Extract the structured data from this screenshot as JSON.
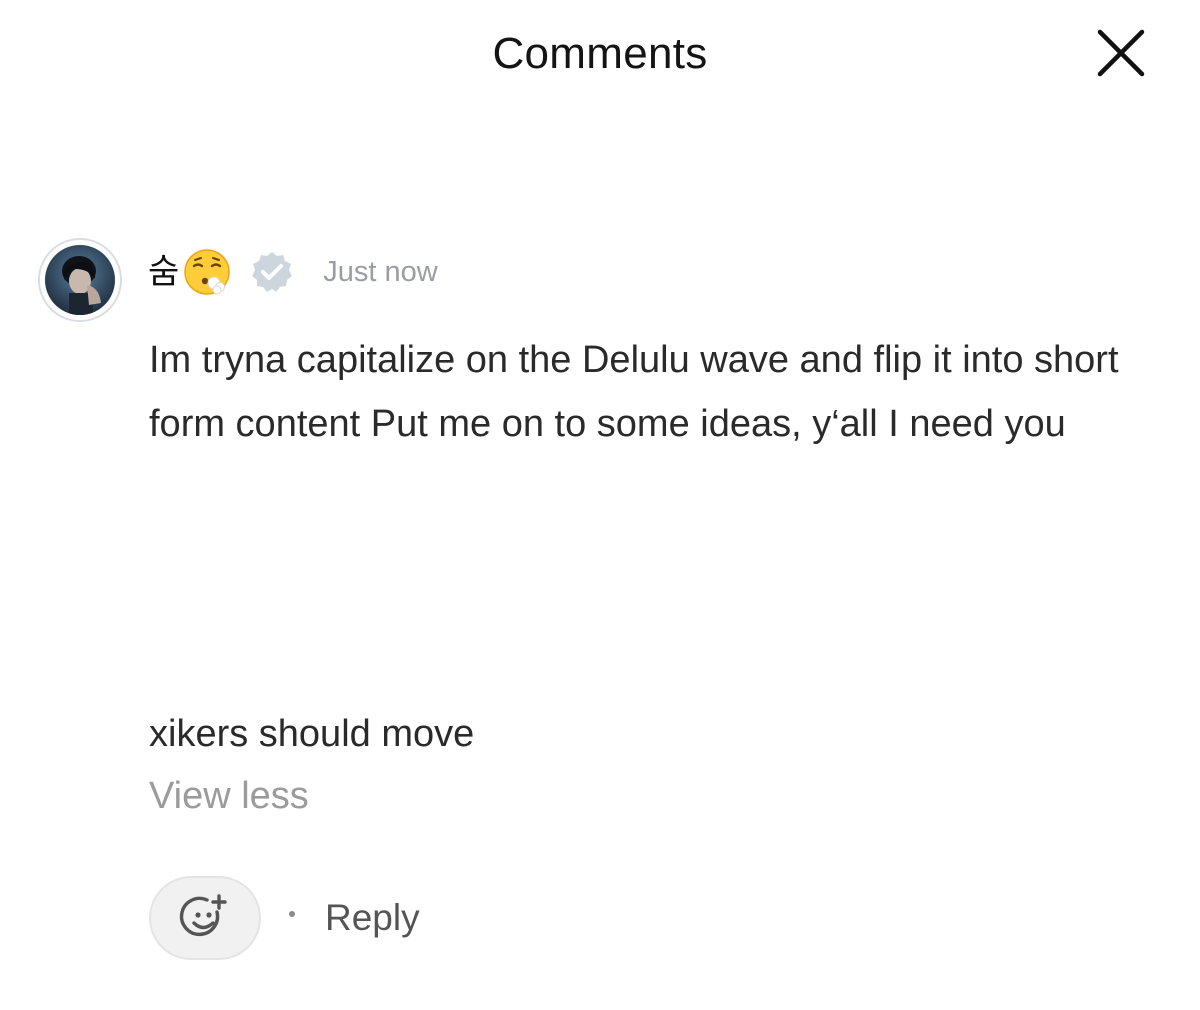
{
  "header": {
    "title": "Comments",
    "close_icon": "close-icon"
  },
  "comment": {
    "avatar_icon": "avatar",
    "username": "숨",
    "username_emoji": "face-exhaling-emoji",
    "verified_icon": "verified-check-icon",
    "timestamp": "Just now",
    "text": "Im tryna capitalize on the Delulu wave and flip it into short form content Put me on to some ideas, y‘all I need you",
    "extra_text": "xikers should move",
    "view_less": "View less",
    "reaction_icon": "add-reaction-icon",
    "reply_label": "Reply"
  },
  "colors": {
    "background": "#ffffff",
    "primary_text": "#2a2a2a",
    "muted_text": "#9b9b9b",
    "verified_badge": "#c9d1db",
    "reaction_button_bg": "#f1f1f2"
  }
}
